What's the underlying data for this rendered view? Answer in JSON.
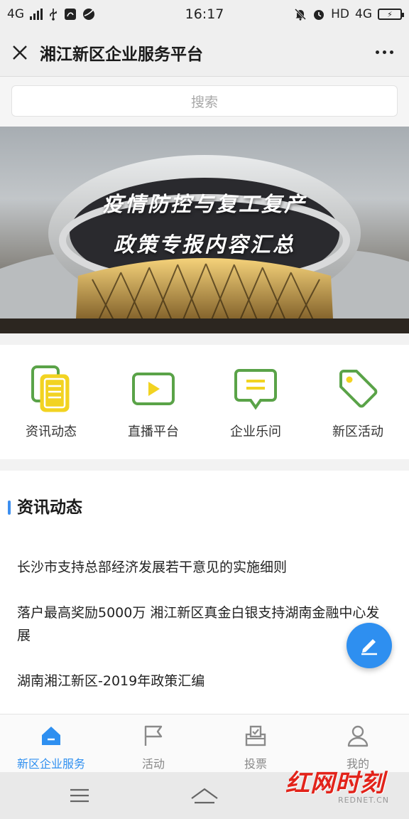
{
  "status_bar": {
    "network_left": "4G",
    "time": "16:17",
    "hd_label": "HD",
    "network_right": "4G"
  },
  "header": {
    "title": "湘江新区企业服务平台"
  },
  "search": {
    "placeholder": "搜索"
  },
  "banner": {
    "line1": "疫情防控与复工复产",
    "line2": "政策专报内容汇总"
  },
  "quick_menu": [
    {
      "label": "资讯动态",
      "icon": "news-documents-icon"
    },
    {
      "label": "直播平台",
      "icon": "live-play-icon"
    },
    {
      "label": "企业乐问",
      "icon": "chat-bubble-icon"
    },
    {
      "label": "新区活动",
      "icon": "tag-icon"
    }
  ],
  "news": {
    "section_title": "资讯动态",
    "items": [
      "长沙市支持总部经济发展若干意见的实施细则",
      "落户最高奖励5000万 湘江新区真金白银支持湖南金融中心发展",
      "湖南湘江新区-2019年政策汇编"
    ]
  },
  "tabbar": [
    {
      "label": "新区企业服务",
      "icon": "home-icon",
      "active": true
    },
    {
      "label": "活动",
      "icon": "flag-icon",
      "active": false
    },
    {
      "label": "投票",
      "icon": "ballot-box-icon",
      "active": false
    },
    {
      "label": "我的",
      "icon": "person-icon",
      "active": false
    }
  ],
  "watermark": {
    "main": "红网时刻",
    "sub": "REDNET.CN"
  },
  "colors": {
    "accent_blue": "#2e8ff0",
    "icon_green": "#5aa348",
    "icon_yellow": "#f2d321",
    "watermark_red": "#e2231a"
  }
}
